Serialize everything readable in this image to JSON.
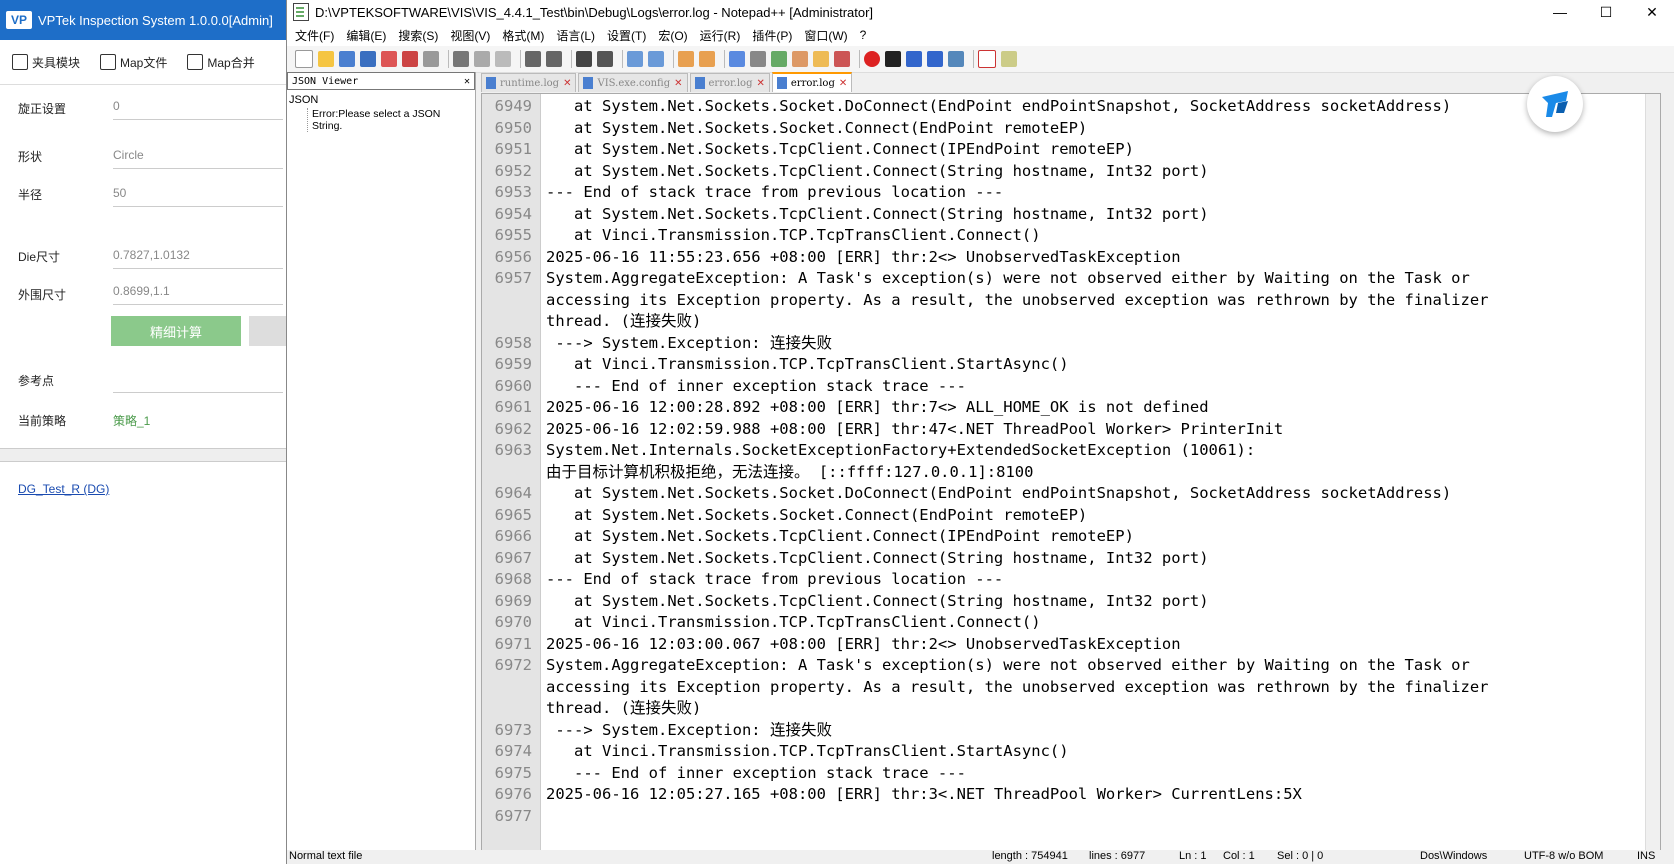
{
  "vptek": {
    "title": "VPTek Inspection System 1.0.0.0[Admin]",
    "logo": "VP",
    "toolbar": [
      {
        "icon": "tools-icon",
        "label": "夹具模块"
      },
      {
        "icon": "map-file-icon",
        "label": "Map文件"
      },
      {
        "icon": "map-merge-icon",
        "label": "Map合并"
      }
    ],
    "fields": {
      "rotate": {
        "label": "旋正设置",
        "value": "0"
      },
      "shape": {
        "label": "形状",
        "value": "Circle"
      },
      "radius": {
        "label": "半径",
        "value": "50"
      },
      "die_size": {
        "label": "Die尺寸",
        "value": "0.7827,1.0132"
      },
      "outer_size": {
        "label": "外围尺寸",
        "value": "0.8699,1.1"
      },
      "ref_point": {
        "label": "参考点",
        "value": ""
      },
      "strategy": {
        "label": "当前策略",
        "value": "策略_1"
      }
    },
    "calc_button": "精细计算",
    "link": "DG_Test_R (DG)"
  },
  "npp": {
    "title": "D:\\VPTEKSOFTWARE\\VIS\\VIS_4.4.1_Test\\bin\\Debug\\Logs\\error.log - Notepad++ [Administrator]",
    "menu": [
      "文件(F)",
      "编辑(E)",
      "搜索(S)",
      "视图(V)",
      "格式(M)",
      "语言(L)",
      "设置(T)",
      "宏(O)",
      "运行(R)",
      "插件(P)",
      "窗口(W)",
      "?"
    ],
    "json_viewer": {
      "header": "JSON Viewer",
      "root": "JSON",
      "child": "Error:Please select a JSON String."
    },
    "tabs": [
      {
        "label": "runtime.log",
        "active": false
      },
      {
        "label": "VIS.exe.config",
        "active": false
      },
      {
        "label": "error.log",
        "active": false
      },
      {
        "label": "error.log",
        "active": true
      }
    ],
    "lines": [
      {
        "n": "6949",
        "t": "   at System.Net.Sockets.Socket.DoConnect(EndPoint endPointSnapshot, SocketAddress socketAddress)"
      },
      {
        "n": "6950",
        "t": "   at System.Net.Sockets.Socket.Connect(EndPoint remoteEP)"
      },
      {
        "n": "6951",
        "t": "   at System.Net.Sockets.TcpClient.Connect(IPEndPoint remoteEP)"
      },
      {
        "n": "6952",
        "t": "   at System.Net.Sockets.TcpClient.Connect(String hostname, Int32 port)"
      },
      {
        "n": "6953",
        "t": "--- End of stack trace from previous location ---"
      },
      {
        "n": "6954",
        "t": "   at System.Net.Sockets.TcpClient.Connect(String hostname, Int32 port)"
      },
      {
        "n": "6955",
        "t": "   at Vinci.Transmission.TCP.TcpTransClient.Connect()"
      },
      {
        "n": "6956",
        "t": "2025-06-16 11:55:23.656 +08:00 [ERR] thr:2<> UnobservedTaskException"
      },
      {
        "n": "6957",
        "t": "System.AggregateException: A Task's exception(s) were not observed either by Waiting on the Task or"
      },
      {
        "n": "",
        "t": "accessing its Exception property. As a result, the unobserved exception was rethrown by the finalizer"
      },
      {
        "n": "",
        "t": "thread. (连接失败)"
      },
      {
        "n": "6958",
        "t": " ---> System.Exception: 连接失败"
      },
      {
        "n": "6959",
        "t": "   at Vinci.Transmission.TCP.TcpTransClient.StartAsync()"
      },
      {
        "n": "6960",
        "t": "   --- End of inner exception stack trace ---"
      },
      {
        "n": "6961",
        "t": "2025-06-16 12:00:28.892 +08:00 [ERR] thr:7<> ALL_HOME_OK is not defined"
      },
      {
        "n": "6962",
        "t": "2025-06-16 12:02:59.988 +08:00 [ERR] thr:47<.NET ThreadPool Worker> PrinterInit"
      },
      {
        "n": "6963",
        "t": "System.Net.Internals.SocketExceptionFactory+ExtendedSocketException (10061):"
      },
      {
        "n": "",
        "t": "由于目标计算机积极拒绝，无法连接。 [::ffff:127.0.0.1]:8100"
      },
      {
        "n": "6964",
        "t": "   at System.Net.Sockets.Socket.DoConnect(EndPoint endPointSnapshot, SocketAddress socketAddress)"
      },
      {
        "n": "6965",
        "t": "   at System.Net.Sockets.Socket.Connect(EndPoint remoteEP)"
      },
      {
        "n": "6966",
        "t": "   at System.Net.Sockets.TcpClient.Connect(IPEndPoint remoteEP)"
      },
      {
        "n": "6967",
        "t": "   at System.Net.Sockets.TcpClient.Connect(String hostname, Int32 port)"
      },
      {
        "n": "6968",
        "t": "--- End of stack trace from previous location ---"
      },
      {
        "n": "6969",
        "t": "   at System.Net.Sockets.TcpClient.Connect(String hostname, Int32 port)"
      },
      {
        "n": "6970",
        "t": "   at Vinci.Transmission.TCP.TcpTransClient.Connect()"
      },
      {
        "n": "6971",
        "t": "2025-06-16 12:03:00.067 +08:00 [ERR] thr:2<> UnobservedTaskException"
      },
      {
        "n": "6972",
        "t": "System.AggregateException: A Task's exception(s) were not observed either by Waiting on the Task or"
      },
      {
        "n": "",
        "t": "accessing its Exception property. As a result, the unobserved exception was rethrown by the finalizer"
      },
      {
        "n": "",
        "t": "thread. (连接失败)"
      },
      {
        "n": "6973",
        "t": " ---> System.Exception: 连接失败"
      },
      {
        "n": "6974",
        "t": "   at Vinci.Transmission.TCP.TcpTransClient.StartAsync()"
      },
      {
        "n": "6975",
        "t": "   --- End of inner exception stack trace ---"
      },
      {
        "n": "6976",
        "t": "2025-06-16 12:05:27.165 +08:00 [ERR] thr:3<.NET ThreadPool Worker> CurrentLens:5X"
      },
      {
        "n": "6977",
        "t": ""
      }
    ],
    "status": {
      "file_type": "Normal text file",
      "length": "length : 754941",
      "lines": "lines : 6977",
      "ln": "Ln : 1",
      "col": "Col : 1",
      "sel": "Sel : 0 | 0",
      "eol": "Dos\\Windows",
      "encoding": "UTF-8 w/o BOM",
      "mode": "INS"
    }
  },
  "colors": {
    "vp_title": "#1e6ec8",
    "calc_button": "#8bc98b",
    "tab_active_accent": "#ff9900"
  }
}
